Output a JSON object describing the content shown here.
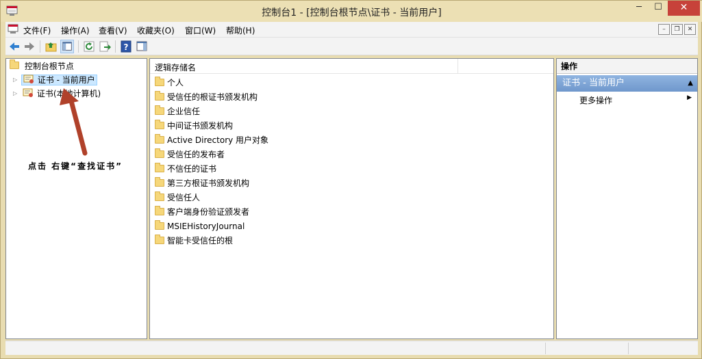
{
  "window": {
    "title": "控制台1 - [控制台根节点\\证书 - 当前用户]",
    "minimize": "─",
    "maximize": "☐",
    "close": "✕"
  },
  "menu": {
    "items": [
      "文件(F)",
      "操作(A)",
      "查看(V)",
      "收藏夹(O)",
      "窗口(W)",
      "帮助(H)"
    ],
    "mdi_min": "–",
    "mdi_restore": "❐",
    "mdi_close": "✕"
  },
  "tree": {
    "root": "控制台根节点",
    "nodes": [
      {
        "label": "证书 - 当前用户"
      },
      {
        "label": "证书(本地计算机)"
      }
    ],
    "annotation": "点击 右键“查找证书”"
  },
  "list": {
    "column": "逻辑存储名",
    "items": [
      "个人",
      "受信任的根证书颁发机构",
      "企业信任",
      "中间证书颁发机构",
      "Active Directory 用户对象",
      "受信任的发布者",
      "不信任的证书",
      "第三方根证书颁发机构",
      "受信任人",
      "客户端身份验证颁发者",
      "MSIEHistoryJournal",
      "智能卡受信任的根"
    ]
  },
  "actions": {
    "title": "操作",
    "group": "证书 - 当前用户",
    "collapse": "▲",
    "more": "更多操作",
    "more_arrow": "▶"
  },
  "colors": {
    "annotation_arrow": "#b0412a",
    "action_group": "#7aa0d2",
    "close_button": "#c7423a"
  }
}
